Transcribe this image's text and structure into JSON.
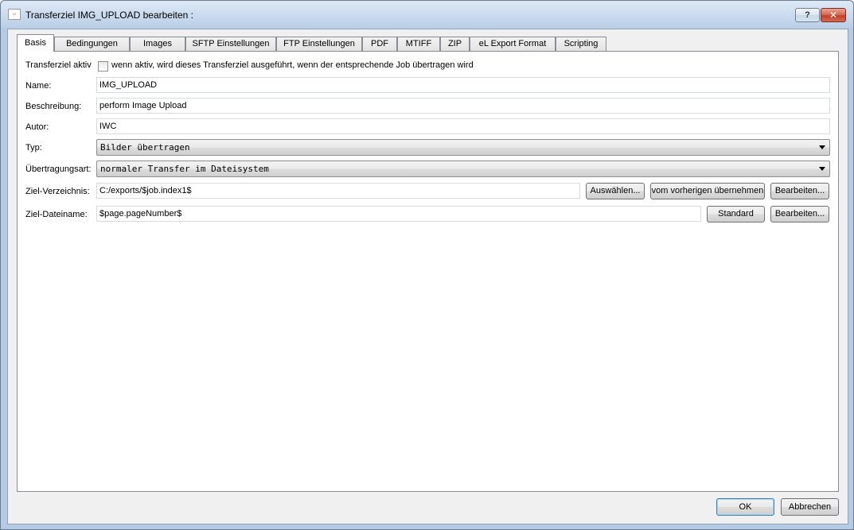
{
  "window": {
    "title": "Transferziel IMG_UPLOAD bearbeiten :",
    "help_glyph": "?",
    "close_glyph": "✕"
  },
  "tabs": [
    {
      "label": "Basis",
      "active": true
    },
    {
      "label": "Bedingungen"
    },
    {
      "label": "Images"
    },
    {
      "label": "SFTP Einstellungen"
    },
    {
      "label": "FTP Einstellungen"
    },
    {
      "label": "PDF"
    },
    {
      "label": "MTIFF"
    },
    {
      "label": "ZIP"
    },
    {
      "label": "eL Export Format"
    },
    {
      "label": "Scripting"
    }
  ],
  "form": {
    "active": {
      "label": "Transferziel aktiv",
      "checked": false,
      "description": "wenn aktiv, wird dieses Transferziel ausgeführt, wenn der entsprechende Job übertragen wird"
    },
    "name": {
      "label": "Name:",
      "value": "IMG_UPLOAD"
    },
    "description": {
      "label": "Beschreibung:",
      "value": "perform Image Upload"
    },
    "author": {
      "label": "Autor:",
      "value": "IWC"
    },
    "type": {
      "label": "Typ:",
      "value": "Bilder übertragen"
    },
    "transfer_mode": {
      "label": "Übertragungsart:",
      "value": "normaler Transfer im Dateisystem"
    },
    "target_dir": {
      "label": "Ziel-Verzeichnis:",
      "value": "C:/exports/$job.index1$",
      "choose_button": "Auswählen...",
      "inherit_button": "vom vorherigen übernehmen",
      "edit_button": "Bearbeiten..."
    },
    "target_file": {
      "label": "Ziel-Dateiname:",
      "value": "$page.pageNumber$",
      "default_button": "Standard",
      "edit_button": "Bearbeiten..."
    }
  },
  "footer": {
    "ok": "OK",
    "cancel": "Abbrechen"
  }
}
